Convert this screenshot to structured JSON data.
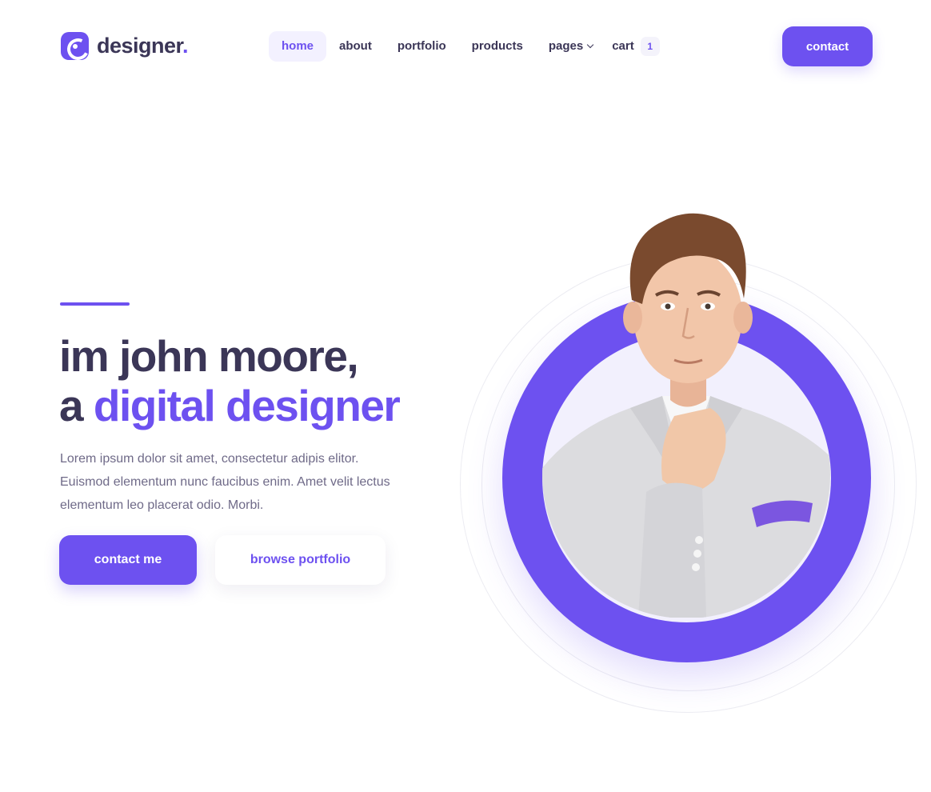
{
  "brand": {
    "name": "designer",
    "dot": ".",
    "logo_icon": "logo-c-icon"
  },
  "nav": {
    "items": [
      {
        "label": "home",
        "active": true
      },
      {
        "label": "about",
        "active": false
      },
      {
        "label": "portfolio",
        "active": false
      },
      {
        "label": "products",
        "active": false
      }
    ],
    "pages_label": "pages",
    "cart_label": "cart",
    "cart_count": "1"
  },
  "header": {
    "contact_label": "contact"
  },
  "hero": {
    "title_line1": "im john moore,",
    "title_line2_prefix": "a ",
    "title_line2_accent": "digital designer",
    "description": "Lorem ipsum dolor sit amet, consectetur adipis elitor. Euismod elementum nunc faucibus enim. Amet velit lectus elementum leo placerat odio. Morbi.",
    "primary_button": "contact me",
    "secondary_button": "browse portfolio"
  },
  "colors": {
    "accent": "#6d51f0",
    "text_dark": "#3b3657",
    "text_muted": "#6f6a88"
  }
}
